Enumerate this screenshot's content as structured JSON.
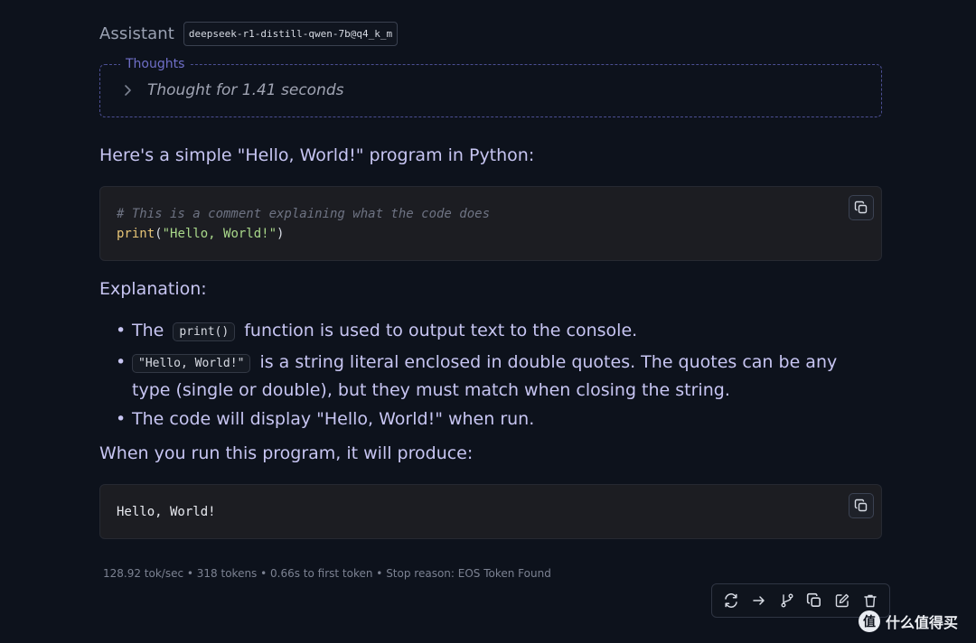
{
  "message": {
    "role": "Assistant",
    "model": "deepseek-r1-distill-qwen-7b@q4_k_m"
  },
  "thoughts": {
    "legend": "Thoughts",
    "summary": "Thought for 1.41 seconds"
  },
  "content": {
    "intro": "Here's a simple \"Hello, World!\" program in Python:",
    "code1": {
      "comment": "# This is a comment explaining what the code does",
      "fn": "print",
      "open": "(",
      "arg": "\"Hello, World!\"",
      "close": ")"
    },
    "explanation_heading": "Explanation:",
    "bullets": [
      {
        "prefix": "The",
        "code": "print()",
        "text": "function is used to output text to the console."
      },
      {
        "code": "\"Hello, World!\"",
        "text": "is a string literal enclosed in double quotes. The quotes can be any type (single or double), but they must match when closing the string."
      },
      {
        "text": "The code will display \"Hello, World!\" when run."
      }
    ],
    "output_intro": "When you run this program, it will produce:",
    "code2": {
      "line": "Hello, World!"
    }
  },
  "stats": "128.92 tok/sec • 318 tokens • 0.66s to first token • Stop reason: EOS Token Found",
  "actions": [
    "regenerate-icon",
    "continue-icon",
    "branch-icon",
    "copy-icon",
    "edit-icon",
    "delete-icon"
  ],
  "watermark": {
    "logo_glyph": "值",
    "text": "什么值得买"
  }
}
